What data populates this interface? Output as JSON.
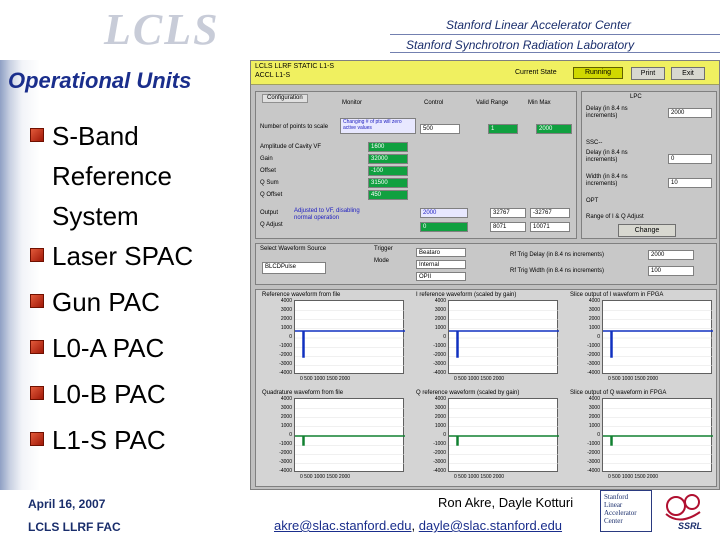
{
  "header": {
    "logo": "LCLS",
    "line1": "Stanford Linear Accelerator Center",
    "line2": "Stanford Synchrotron Radiation Laboratory"
  },
  "slide": {
    "title": "Operational Units",
    "bullets": [
      "S-Band Reference System",
      "Laser SPAC",
      "Gun PAC",
      "L0-A PAC",
      "L0-B PAC",
      "L1-S PAC"
    ]
  },
  "footer": {
    "date": "April 16, 2007",
    "dept": "LCLS LLRF FAC",
    "authors": "Ron Akre, Dayle Kotturi",
    "email1": "akre@slac.stanford.edu",
    "separator": ",",
    "email2": "dayle@slac.stanford.edu",
    "slac_logo": [
      "Stanford",
      "Linear",
      "Accelerator",
      "Center"
    ],
    "ssrl_logo": "SSRL"
  },
  "app": {
    "title1": "LCLS LLRF STATIC L1-S",
    "title2": "ACCL L1-S",
    "state_label": "Current State",
    "state_value": "Running",
    "print_label": "Print",
    "exit_label": "Exit",
    "config_tab": "Configuration",
    "col_monitor": "Monitor",
    "col_control": "Control",
    "col_valid": "Valid Range",
    "col_minmax": "Min Max",
    "num_points_label": "Number of points to scale",
    "num_points_note": "Changing # of pts will zero active values",
    "num_points_value": "500",
    "num_points_control": "1",
    "num_points_max": "2000",
    "cavity_labels": [
      "Amplitude of Cavity VF",
      "Gain",
      "Offset",
      "Q Sum",
      "Q Offset"
    ],
    "cavity_values": [
      "1600",
      "32000",
      "-100",
      "31500",
      "450"
    ],
    "output_label": "Output",
    "output_note": "Adjusted to VF, disabling normal operation",
    "adjust_label": "Q Adjust",
    "output_values": [
      "2000",
      "32767",
      "-32767"
    ],
    "output_values2": [
      "0",
      "8071",
      "10071"
    ],
    "lpc_title": "LPC",
    "delay_label": "Delay (in 8.4 ns increments)",
    "delay_value": "2000",
    "ssc_title": "SSC--",
    "delay2_label": "Delay (in 8.4 ns increments)",
    "delay2_value": "0",
    "width_label": "Width (in 8.4 ns increments)",
    "width_value": "10",
    "opt_label": "OPT",
    "range_label": "Range of I & Q Adjust",
    "change_label": "Change",
    "select_label": "Select Waveform Source",
    "select_value": "BLCDPulse",
    "trigger_label": "Trigger",
    "mode_label": "Mode",
    "mode_values": [
      "Beataro",
      "Internal",
      "OPII"
    ],
    "trig_delay_label": "Rf Trig Delay (in 8.4 ns increments)",
    "trig_delay_value": "2000",
    "trig_width_label": "Rf Trig Width (in 8.4 ns increments)",
    "trig_width_value": "100",
    "plots": [
      {
        "title": "Reference waveform from file",
        "ticks": [
          "4000",
          "3000",
          "2000",
          "1000",
          "0",
          "-1000",
          "-2000",
          "-3000",
          "-4000"
        ],
        "xlabel": "0 500 1000 1500 2000"
      },
      {
        "title": "I reference waveform (scaled by gain)",
        "ticks": [
          "4000",
          "3000",
          "2000",
          "1000",
          "0",
          "-1000",
          "-2000",
          "-3000",
          "-4000"
        ],
        "xlabel": "0 500 1000 1500 2000"
      },
      {
        "title": "Slice output of I waveform in FPGA",
        "ticks": [
          "4000",
          "3000",
          "2000",
          "1000",
          "0",
          "-1000",
          "-2000",
          "-3000",
          "-4000"
        ],
        "xlabel": "0 500 1000 1500 2000"
      },
      {
        "title": "Quadrature waveform from file",
        "ticks": [
          "4000",
          "3000",
          "2000",
          "1000",
          "0",
          "-1000",
          "-2000",
          "-3000",
          "-4000"
        ],
        "xlabel": "0 500 1000 1500 2000"
      },
      {
        "title": "Q reference waveform (scaled by gain)",
        "ticks": [
          "4000",
          "3000",
          "2000",
          "1000",
          "0",
          "-1000",
          "-2000",
          "-3000",
          "-4000"
        ],
        "xlabel": "0 500 1000 1500 2000"
      },
      {
        "title": "Slice output of Q waveform in FPGA",
        "ticks": [
          "4000",
          "3000",
          "2000",
          "1000",
          "0",
          "-1000",
          "-2000",
          "-3000",
          "-4000"
        ],
        "xlabel": "0 500 1000 1500 2000"
      }
    ]
  }
}
